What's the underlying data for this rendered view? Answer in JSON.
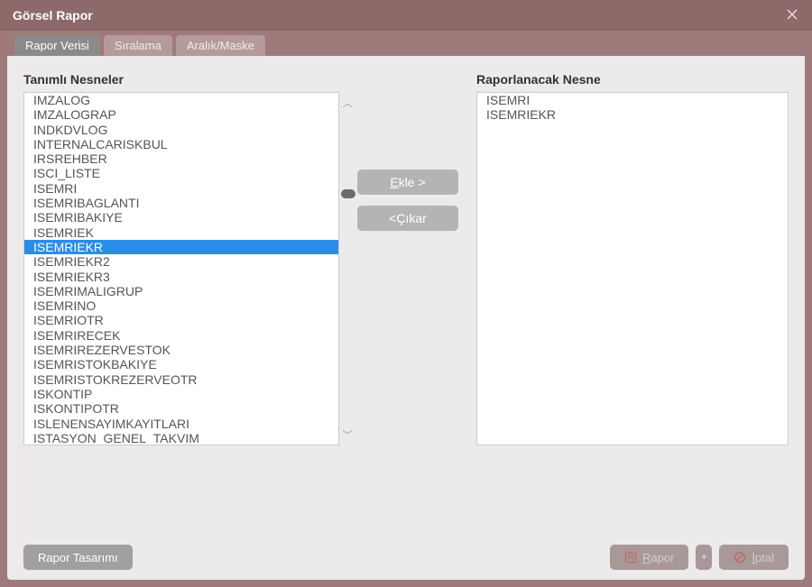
{
  "window": {
    "title": "Görsel Rapor"
  },
  "tabs": [
    {
      "label": "Rapor Verisi",
      "active": true
    },
    {
      "label": "Sıralama",
      "active": false
    },
    {
      "label": "Aralık/Maske",
      "active": false
    }
  ],
  "left": {
    "heading": "Tanımlı Nesneler",
    "items": [
      "IMZALOG",
      "IMZALOGRAP",
      "INDKDVLOG",
      "INTERNALCARISKBUL",
      "IRSREHBER",
      "ISCI_LISTE",
      "ISEMRI",
      "ISEMRIBAGLANTI",
      "ISEMRIBAKIYE",
      "ISEMRIEK",
      "ISEMRIEKR",
      "ISEMRIEKR2",
      "ISEMRIEKR3",
      "ISEMRIMALIGRUP",
      "ISEMRINO",
      "ISEMRIOTR",
      "ISEMRIRECEK",
      "ISEMRIREZERVESTOK",
      "ISEMRISTOKBAKIYE",
      "ISEMRISTOKREZERVEOTR",
      "ISKONTIP",
      "ISKONTIPOTR",
      "ISLENENSAYIMKAYITLARI",
      "ISTASYON_GENEL_TAKVIM"
    ],
    "selected_index": 10
  },
  "right": {
    "heading": "Raporlanacak Nesne",
    "items": [
      "ISEMRI",
      "ISEMRIEKR"
    ]
  },
  "mid": {
    "add_prefix": "E",
    "add_rest": "kle >",
    "remove_prefix": "<Ç",
    "remove_rest": "ıkar"
  },
  "footer": {
    "design": "Rapor Tasarımı",
    "report_underline": "R",
    "report_rest": "apor",
    "cancel_underline": "İ",
    "cancel_rest": "ptal"
  }
}
